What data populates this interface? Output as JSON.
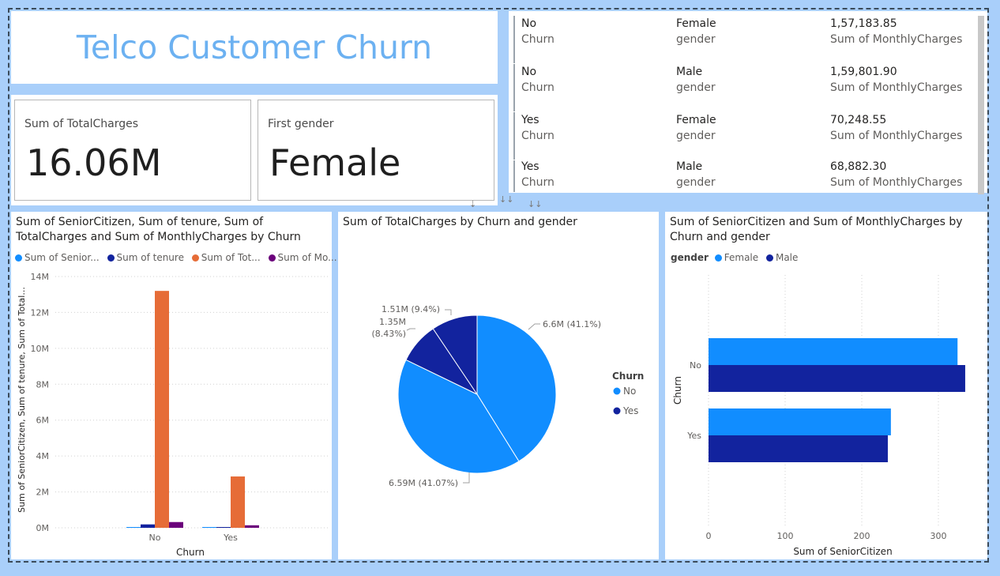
{
  "title": "Telco Customer Churn",
  "cards": [
    {
      "label": "Sum of TotalCharges",
      "value": "16.06M"
    },
    {
      "label": "First gender",
      "value": "Female"
    }
  ],
  "table": {
    "rows": [
      {
        "churn": "No",
        "gender": "Female",
        "value": "1,57,183.85"
      },
      {
        "churn": "No",
        "gender": "Male",
        "value": "1,59,801.90"
      },
      {
        "churn": "Yes",
        "gender": "Female",
        "value": "70,248.55"
      },
      {
        "churn": "Yes",
        "gender": "Male",
        "value": "68,882.30"
      }
    ],
    "churn_label": "Churn",
    "gender_label": "gender",
    "value_label": "Sum of MonthlyCharges"
  },
  "colors": {
    "senior": "#118dff",
    "tenure": "#12239e",
    "total": "#e66c37",
    "monthly": "#6b007b",
    "female": "#118dff",
    "male": "#12239e"
  },
  "chart_data": [
    {
      "type": "bar",
      "title": "Sum of SeniorCitizen, Sum of tenure, Sum of TotalCharges and Sum of MonthlyCharges by Churn",
      "categories": [
        "No",
        "Yes"
      ],
      "series": [
        {
          "name": "Sum of Senior...",
          "values": [
            0.0007,
            0.0005
          ]
        },
        {
          "name": "Sum of tenure",
          "values": [
            0.19,
            0.03
          ]
        },
        {
          "name": "Sum of Tot...",
          "values": [
            13.2,
            2.86
          ]
        },
        {
          "name": "Sum of Mo...",
          "values": [
            0.32,
            0.14
          ]
        }
      ],
      "xlabel": "Churn",
      "ylabel": "Sum of SeniorCitizen, Sum of tenure, Sum of Total...",
      "yticks": [
        "0M",
        "2M",
        "4M",
        "6M",
        "8M",
        "10M",
        "12M",
        "14M"
      ],
      "ylim": [
        0,
        14
      ],
      "grid": true,
      "legend_position": "top"
    },
    {
      "type": "pie",
      "title": "Sum of TotalCharges by Churn and gender",
      "slices": [
        {
          "churn": "No",
          "gender": "Female",
          "value": 6.6,
          "label": "6.6M (41.1%)"
        },
        {
          "churn": "No",
          "gender": "Male",
          "value": 6.59,
          "label": "6.59M (41.07%)"
        },
        {
          "churn": "Yes",
          "gender": "Female",
          "value": 1.35,
          "label_line1": "1.35M",
          "label_line2": "(8.43%)"
        },
        {
          "churn": "Yes",
          "gender": "Male",
          "value": 1.51,
          "label": "1.51M (9.4%)"
        }
      ],
      "legend_title": "Churn",
      "legend": [
        "No",
        "Yes"
      ],
      "legend_position": "right"
    },
    {
      "type": "bar",
      "orientation": "horizontal",
      "title": "Sum of SeniorCitizen and Sum of MonthlyCharges by Churn and gender",
      "legend_title": "gender",
      "categories": [
        "No",
        "Yes"
      ],
      "series": [
        {
          "name": "Female",
          "values": [
            325,
            238
          ]
        },
        {
          "name": "Male",
          "values": [
            335,
            234
          ]
        }
      ],
      "xlabel": "Sum of SeniorCitizen",
      "ylabel": "Churn",
      "xticks": [
        "0",
        "100",
        "200",
        "300"
      ],
      "xlim": [
        0,
        345
      ],
      "grid": true,
      "legend_position": "top"
    }
  ]
}
